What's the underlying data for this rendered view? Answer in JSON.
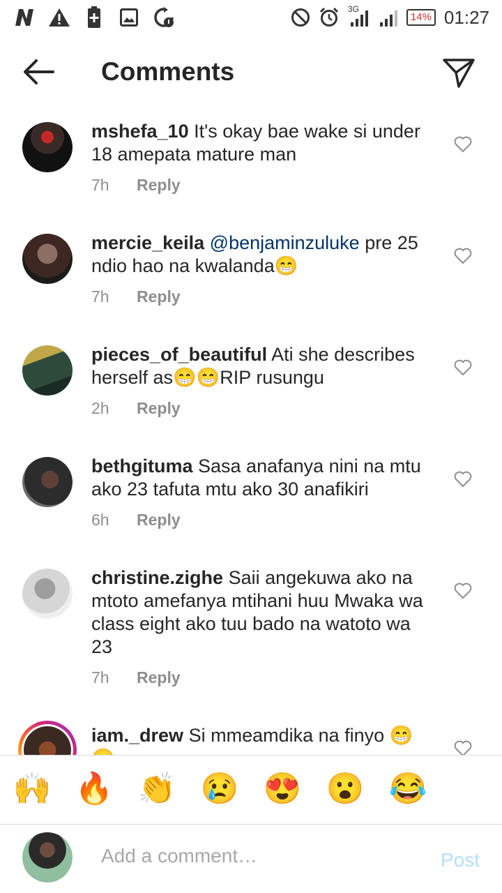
{
  "status_bar": {
    "network": "3G",
    "battery": "14%",
    "time": "01:27"
  },
  "header": {
    "title": "Comments"
  },
  "comments": [
    {
      "username": "mshefa_10",
      "text": "It's okay bae wake si under 18 amepata mature man",
      "time": "7h",
      "reply_label": "Reply"
    },
    {
      "username": "mercie_keila",
      "mention": "@benjaminzuluke",
      "text": "pre 25 ndio hao na kwalanda😁",
      "time": "7h",
      "reply_label": "Reply"
    },
    {
      "username": "pieces_of_beautiful",
      "text": "Ati she describes herself as😁😁RIP rusungu",
      "time": "2h",
      "reply_label": "Reply"
    },
    {
      "username": "bethgituma",
      "text": "Sasa anafanya nini na mtu ako 23 tafuta mtu ako 30 anafikiri",
      "time": "6h",
      "reply_label": "Reply"
    },
    {
      "username": "christine.zighe",
      "text": "Saii angekuwa ako na mtoto amefanya mtihani huu Mwaka wa class eight ako tuu bado na watoto wa 23",
      "time": "7h",
      "reply_label": "Reply"
    },
    {
      "username": "iam._drew",
      "text": "Si mmeamdika na finyo 😁 😁",
      "time": "",
      "reply_label": ""
    }
  ],
  "emoji_bar": [
    "🙌",
    "🔥",
    "👏",
    "😢",
    "😍",
    "😮",
    "😂"
  ],
  "input": {
    "placeholder": "Add a comment…",
    "post_label": "Post"
  },
  "colors": {
    "mention": "#003569",
    "post_disabled": "#b2dffc",
    "meta": "#8e8e8e"
  }
}
